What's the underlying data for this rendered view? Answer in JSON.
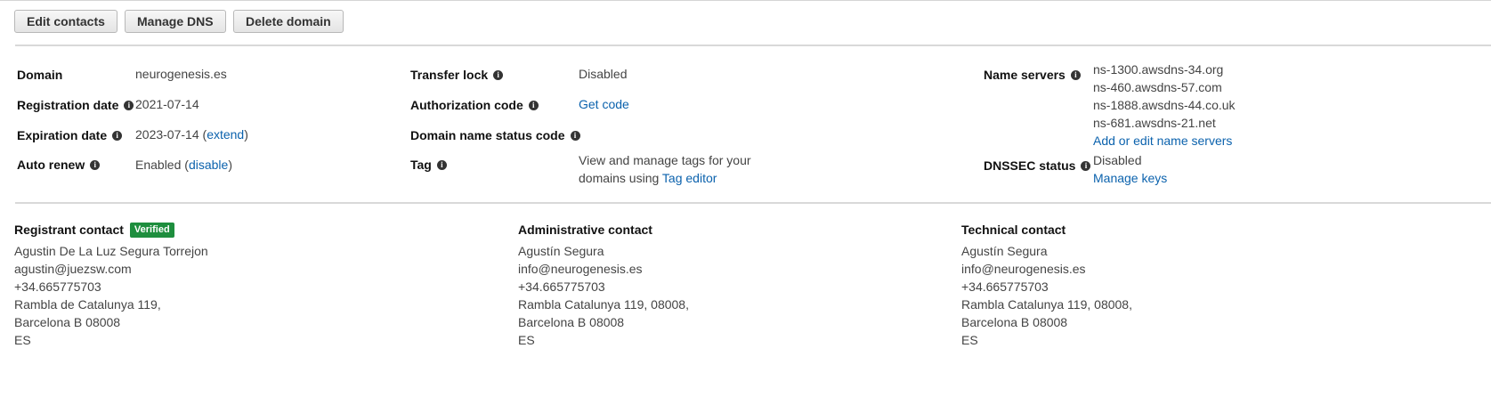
{
  "toolbar": {
    "edit_contacts": "Edit contacts",
    "manage_dns": "Manage DNS",
    "delete_domain": "Delete domain"
  },
  "details": {
    "domain_label": "Domain",
    "domain_value": "neurogenesis.es",
    "registration_date_label": "Registration date",
    "registration_date_value": "2021-07-14",
    "expiration_date_label": "Expiration date",
    "expiration_date_value": "2023-07-14",
    "extend_link": "extend",
    "auto_renew_label": "Auto renew",
    "auto_renew_value": "Enabled",
    "disable_link": "disable",
    "transfer_lock_label": "Transfer lock",
    "transfer_lock_value": "Disabled",
    "authorization_code_label": "Authorization code",
    "get_code_link": "Get code",
    "domain_status_label": "Domain name status code",
    "tag_label": "Tag",
    "tag_text_line1": "View and manage tags for your",
    "tag_text_line2": "domains using",
    "tag_editor_link": "Tag editor",
    "name_servers_label": "Name servers",
    "name_servers": [
      "ns-1300.awsdns-34.org",
      "ns-460.awsdns-57.com",
      "ns-1888.awsdns-44.co.uk",
      "ns-681.awsdns-21.net"
    ],
    "edit_name_servers_link": "Add or edit name servers",
    "dnssec_label": "DNSSEC status",
    "dnssec_value": "Disabled",
    "manage_keys_link": "Manage keys"
  },
  "contacts": {
    "registrant": {
      "title": "Registrant contact",
      "badge": "Verified",
      "lines": [
        "Agustin De La Luz Segura Torrejon",
        "agustin@juezsw.com",
        "+34.665775703",
        "Rambla de Catalunya 119,",
        "Barcelona B 08008",
        "ES"
      ]
    },
    "administrative": {
      "title": "Administrative contact",
      "lines": [
        "Agustín Segura",
        "info@neurogenesis.es",
        "+34.665775703",
        "Rambla Catalunya 119, 08008,",
        "Barcelona B 08008",
        "ES"
      ]
    },
    "technical": {
      "title": "Technical contact",
      "lines": [
        "Agustín Segura",
        "info@neurogenesis.es",
        "+34.665775703",
        "Rambla Catalunya 119, 08008,",
        "Barcelona B 08008",
        "ES"
      ]
    }
  }
}
